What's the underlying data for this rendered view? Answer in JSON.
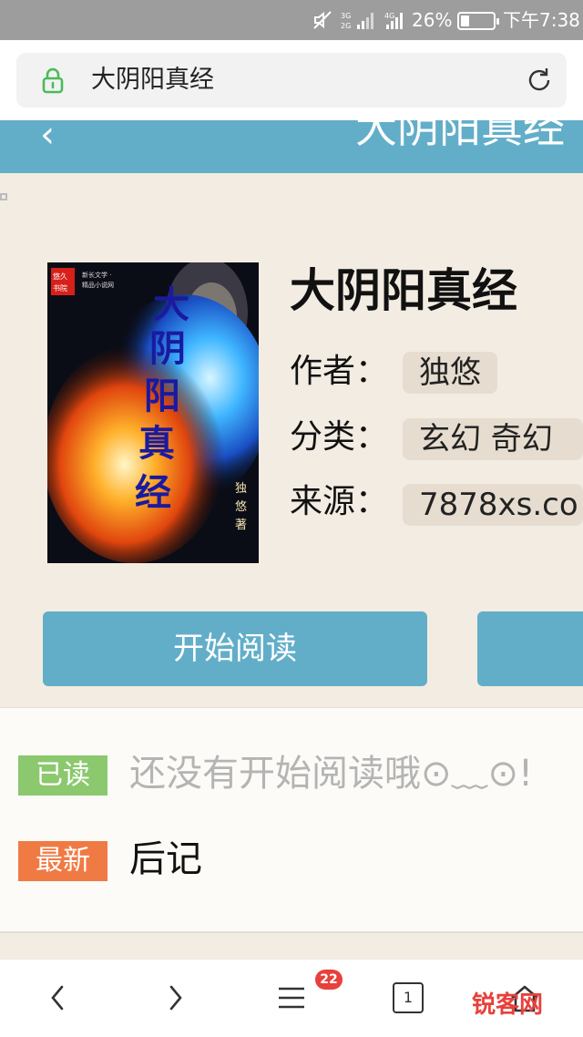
{
  "status_bar": {
    "network_1": "3G 2G",
    "network_2": "4G",
    "battery_percent": "26%",
    "battery_level": 0.26,
    "time": "下午7:38"
  },
  "browser": {
    "url_title": "大阴阳真经"
  },
  "site_header": {
    "back_glyph": "‹",
    "title": "大阴阳真经"
  },
  "book": {
    "title": "大阴阳真经",
    "author_label": "作者：",
    "author": "独悠",
    "category_label": "分类：",
    "category": "玄幻 奇幻",
    "source_label": "来源：",
    "source": "7878xs.co",
    "cover_title": "大阴阳真经",
    "cover_author": "独悠著"
  },
  "actions": {
    "start_reading": "开始阅读"
  },
  "reading": {
    "read_tag": "已读",
    "read_text": "还没有开始阅读哦⊙﹏⊙!",
    "latest_tag": "最新",
    "latest_text": "后记"
  },
  "bottom_nav": {
    "menu_badge": "22",
    "tab_count": "1"
  },
  "watermark": "锐客网",
  "colors": {
    "accent": "#62aec9",
    "read_tag": "#8bc86e",
    "new_tag": "#f07a44",
    "page_bg": "#f3ece2"
  }
}
